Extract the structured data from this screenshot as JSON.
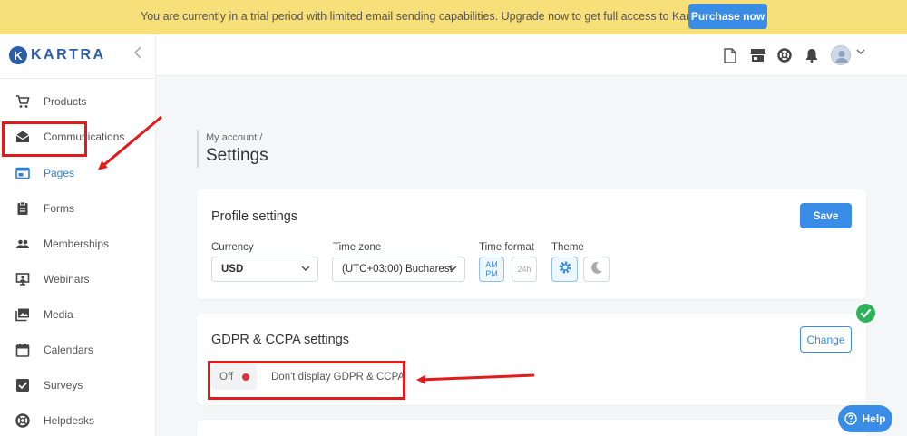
{
  "banner": {
    "text": "You are currently in a trial period with limited email sending capabilities. Upgrade now to get full access to Kartra!",
    "button_label": "Purchase now",
    "color": "#f7df7a"
  },
  "logo": {
    "mark": "K",
    "text": "KARTRA"
  },
  "sidebar": {
    "items": [
      {
        "label": "Products",
        "icon": "cart-icon"
      },
      {
        "label": "Communications",
        "icon": "envelope-icon"
      },
      {
        "label": "Pages",
        "icon": "browser-window-icon",
        "active": true
      },
      {
        "label": "Forms",
        "icon": "clipboard-icon"
      },
      {
        "label": "Memberships",
        "icon": "people-icon"
      },
      {
        "label": "Webinars",
        "icon": "presentation-icon"
      },
      {
        "label": "Media",
        "icon": "image-gallery-icon"
      },
      {
        "label": "Calendars",
        "icon": "calendar-icon"
      },
      {
        "label": "Surveys",
        "icon": "checkbox-icon"
      },
      {
        "label": "Helpdesks",
        "icon": "lifebuoy-icon"
      }
    ]
  },
  "topbar": {
    "icons": [
      "document-icon",
      "store-icon",
      "lifebuoy-icon",
      "bell-icon",
      "avatar-icon"
    ]
  },
  "header": {
    "breadcrumb": "My account /",
    "title": "Settings"
  },
  "profile": {
    "title": "Profile settings",
    "save_label": "Save",
    "currency_label": "Currency",
    "currency_value": "USD",
    "timezone_label": "Time zone",
    "timezone_value": "(UTC+03:00) Bucharest",
    "timeformat_label": "Time format",
    "timeformat_ampm": "AM PM",
    "timeformat_24h": "24h",
    "theme_label": "Theme"
  },
  "gdpr": {
    "title": "GDPR & CCPA settings",
    "change_label": "Change",
    "toggle_label": "Off",
    "status_text": "Don't display GDPR & CCPA"
  },
  "help": {
    "label": "Help"
  },
  "colors": {
    "accent": "#3a8de6",
    "annotation_red": "#e11b1b",
    "success": "#2db45a",
    "off_dot": "#e0313a"
  }
}
